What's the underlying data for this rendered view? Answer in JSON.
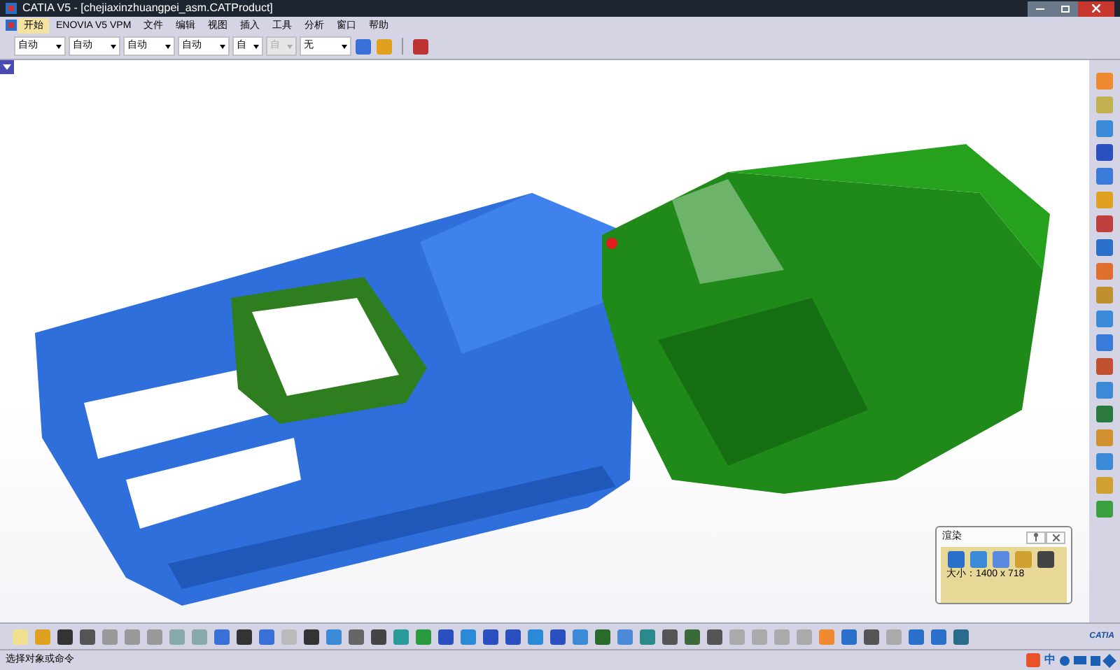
{
  "window": {
    "title": "CATIA V5 - [chejiaxinzhuangpei_asm.CATProduct]"
  },
  "menu_bar": {
    "items": [
      {
        "label": "开始",
        "selected": true
      },
      {
        "label": "ENOVIA V5 VPM",
        "selected": false
      },
      {
        "label": "文件",
        "selected": false
      },
      {
        "label": "编辑",
        "selected": false
      },
      {
        "label": "视图",
        "selected": false
      },
      {
        "label": "插入",
        "selected": false
      },
      {
        "label": "工具",
        "selected": false
      },
      {
        "label": "分析",
        "selected": false
      },
      {
        "label": "窗口",
        "selected": false
      },
      {
        "label": "帮助",
        "selected": false
      }
    ]
  },
  "graphic_properties": {
    "dropdowns": [
      {
        "value": "自动",
        "disabled": false
      },
      {
        "value": "自动",
        "disabled": false
      },
      {
        "value": "自动",
        "disabled": false
      },
      {
        "value": "自动",
        "disabled": false
      },
      {
        "value": "自",
        "disabled": false
      },
      {
        "value": "自",
        "disabled": true
      },
      {
        "value": "无",
        "disabled": false
      }
    ]
  },
  "render_panel": {
    "title": "渲染",
    "size": "大小：1400 x 718"
  },
  "logo": {
    "text": "CATIA"
  },
  "status_bar": {
    "prompt": "选择对象或命令",
    "ime": "中"
  }
}
